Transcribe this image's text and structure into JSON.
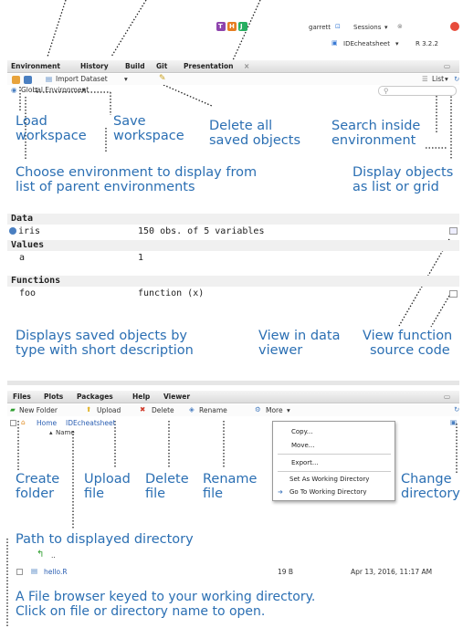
{
  "top": {
    "badges": [
      "T",
      "H",
      "J"
    ],
    "user": "garrett",
    "sessions": "Sessions",
    "project": "IDEcheatsheet",
    "version": "R 3.2.2"
  },
  "env_pane": {
    "tabs": [
      "Environment",
      "History",
      "Build",
      "Git",
      "Presentation"
    ],
    "import_label": "Import Dataset",
    "env_select": "Global Environment",
    "list_label": "List",
    "search_placeholder": "",
    "data_header": "Data",
    "values_header": "Values",
    "functions_header": "Functions",
    "data_rows": [
      {
        "name": "iris",
        "value": "150 obs. of 5 variables"
      }
    ],
    "value_rows": [
      {
        "name": "a",
        "value": "1"
      }
    ],
    "function_rows": [
      {
        "name": "foo",
        "value": "function (x)"
      }
    ]
  },
  "files_pane": {
    "tabs": [
      "Files",
      "Plots",
      "Packages",
      "Help",
      "Viewer"
    ],
    "toolbar": {
      "new_folder": "New Folder",
      "upload": "Upload",
      "delete": "Delete",
      "rename": "Rename",
      "more": "More"
    },
    "breadcrumb": {
      "home": "Home",
      "dir": "IDEcheatsheet"
    },
    "name_header": "Name",
    "up_label": "..",
    "file": {
      "name": "hello.R",
      "size": "19 B",
      "modified": "Apr 13, 2016, 11:17 AM"
    },
    "menu": [
      "Copy...",
      "Move...",
      "Export...",
      "Set As Working Directory",
      "Go To Working Directory"
    ]
  },
  "annotations": {
    "load_ws": [
      "Load",
      "workspace"
    ],
    "save_ws": [
      "Save",
      "workspace"
    ],
    "delete_all": [
      "Delete all",
      "saved objects"
    ],
    "search_env": [
      "Search inside",
      "environment"
    ],
    "choose_env": [
      "Choose environment to display from",
      "list of parent environments"
    ],
    "display_as": [
      "Display objects",
      "as list or grid"
    ],
    "saved_objects": [
      "Displays saved objects by",
      "type with short description"
    ],
    "data_viewer": [
      "View in data",
      "viewer"
    ],
    "func_source": [
      "View function",
      "source code"
    ],
    "create_folder": [
      "Create",
      "folder"
    ],
    "upload_file": [
      "Upload",
      "file"
    ],
    "delete_file": [
      "Delete",
      "file"
    ],
    "rename_file": [
      "Rename",
      "file"
    ],
    "change_dir": [
      "Change",
      "directory"
    ],
    "path_dir": "Path to displayed directory",
    "file_browser": [
      "A File browser keyed to your working directory.",
      "Click on file or directory name to open."
    ]
  },
  "colors": {
    "annotation": "#2b6fb3",
    "badge_t": "#8e44ad",
    "badge_h": "#e67e22",
    "badge_j": "#27ae60"
  }
}
